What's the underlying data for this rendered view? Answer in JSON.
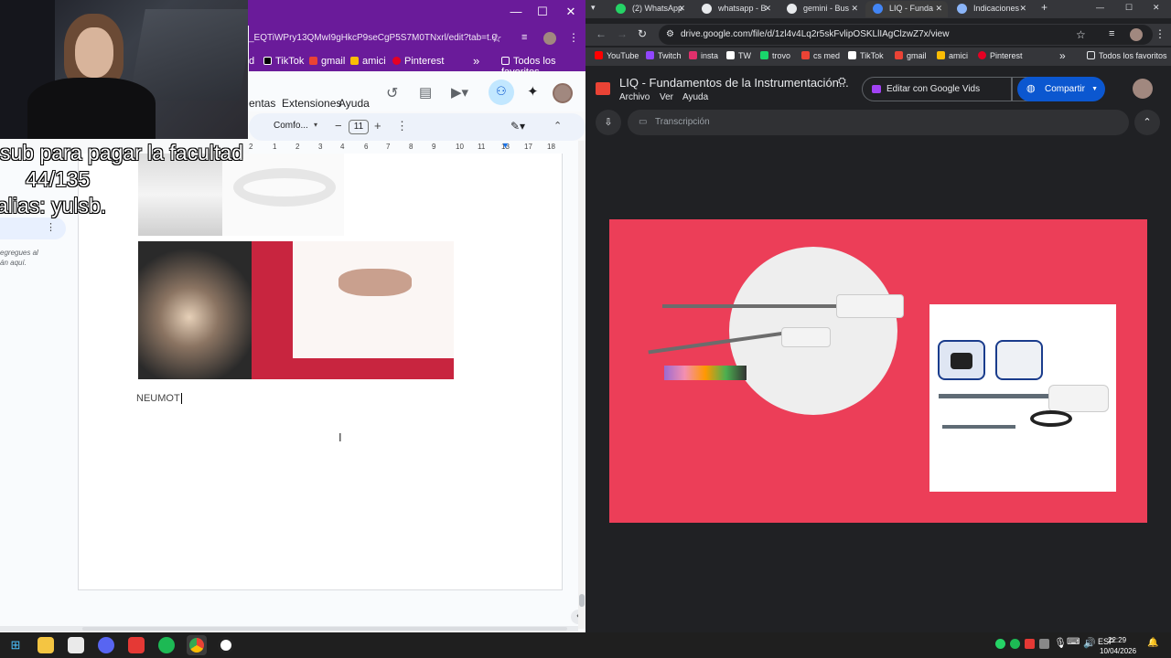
{
  "left_window": {
    "url": "_EQTiWPry13QMwI9gHkcP9seCgP5S7M0TNxrl/edit?tab=t.0",
    "window_controls": {
      "minimize": "—",
      "maximize": "☐",
      "close": "✕"
    },
    "bookmarks": [
      "d",
      "TikTok",
      "gmail",
      "amici",
      "Pinterest"
    ],
    "bookmarks_more": "»",
    "bookmarks_folder": "Todos los favoritos",
    "menu": [
      "entas",
      "Extensiones",
      "Ayuda"
    ],
    "toolbar": {
      "font": "Comfo...",
      "font_size": "11",
      "minus": "−",
      "plus": "+"
    },
    "ruler_ticks": [
      "2",
      "1",
      "1",
      "2",
      "3",
      "4",
      "5",
      "6",
      "7",
      "8",
      "9",
      "10",
      "11",
      "12",
      "13",
      "14",
      "15",
      "16",
      "17",
      "18"
    ],
    "outline_text": "egregues al\nán aquí.",
    "doc_text": "NEUMOT",
    "scroll_arrow": "‹"
  },
  "overlay": {
    "line1": "sub para pagar la facultad",
    "line2": "44/135",
    "line3": "alias: yulsb."
  },
  "right_window": {
    "tabs": [
      {
        "label": "(2) WhatsApp",
        "color": "#25d366",
        "active": false
      },
      {
        "label": "whatsapp - B",
        "color": "#e8eaed",
        "active": false
      },
      {
        "label": "gemini - Bus",
        "color": "#e8eaed",
        "active": false
      },
      {
        "label": "LIQ - Funda",
        "color": "#4285f4",
        "active": true
      },
      {
        "label": "Indicaciones",
        "color": "#8ab4f8",
        "active": false
      }
    ],
    "new_tab": "+",
    "window_controls": {
      "minimize": "—",
      "maximize": "☐",
      "close": "✕"
    },
    "url": "drive.google.com/file/d/1zl4v4Lq2r5skFvlipOSKLlIAgClzwZ7x/view",
    "bookmarks": [
      {
        "label": "YouTube",
        "color": "#ff0000"
      },
      {
        "label": "Twitch",
        "color": "#9146ff"
      },
      {
        "label": "insta",
        "color": "#e1306c"
      },
      {
        "label": "TW",
        "color": "#ffffff"
      },
      {
        "label": "trovo",
        "color": "#19d66b"
      },
      {
        "label": "cs med",
        "color": "#ea4335"
      },
      {
        "label": "TikTok",
        "color": "#ffffff"
      },
      {
        "label": "gmail",
        "color": "#ea4335"
      },
      {
        "label": "amici",
        "color": "#fbbc04"
      },
      {
        "label": "Pinterest",
        "color": "#e60023"
      }
    ],
    "bookmarks_more": "»",
    "bookmarks_folder": "Todos los favoritos",
    "file_title": "LIQ - Fundamentos de la Instrumentación...",
    "file_menu": [
      "Archivo",
      "Ver",
      "Ayuda"
    ],
    "edit_button": "Editar con Google Vids",
    "share_button": "Compartir",
    "transcript_label": "Transcripción"
  },
  "taskbar": {
    "time": "22:29",
    "date": "10/04/2026",
    "tray_label": "ESP"
  }
}
